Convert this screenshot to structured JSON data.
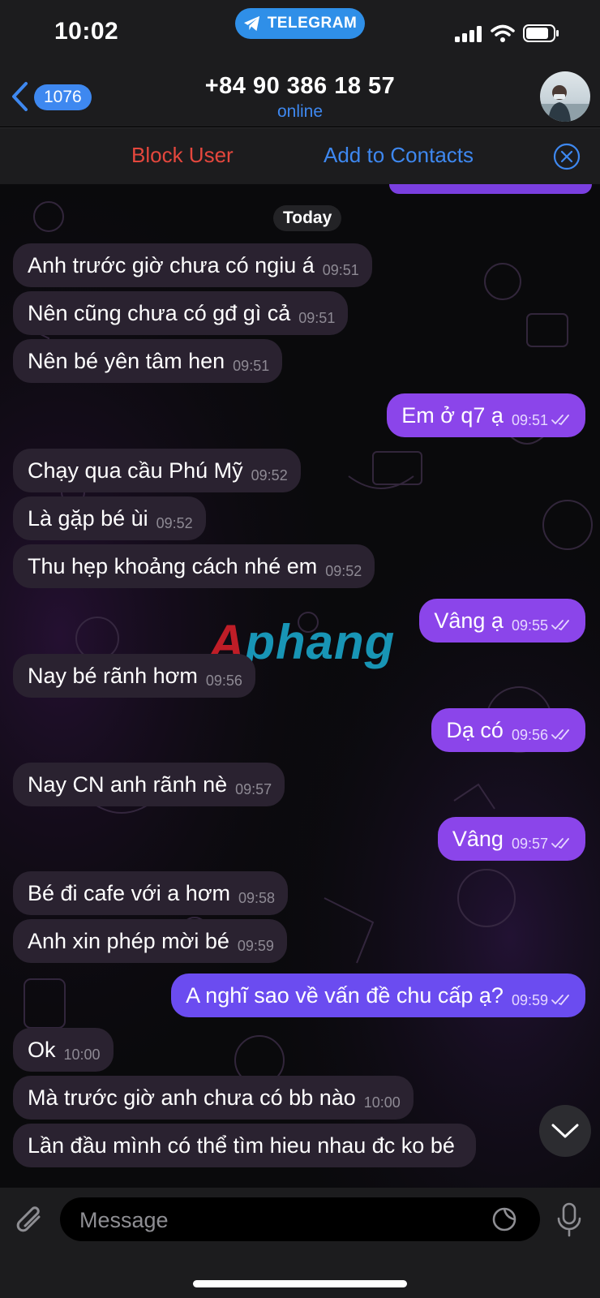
{
  "status_bar": {
    "time": "10:02",
    "app_pill": "TELEGRAM"
  },
  "nav": {
    "back_count": "1076",
    "title": "+84 90 386 18 57",
    "subtitle": "online"
  },
  "actions": {
    "block": "Block User",
    "add": "Add to Contacts"
  },
  "chat": {
    "date_label": "Today",
    "watermark_a": "A",
    "watermark_rest": "phang",
    "messages": [
      {
        "dir": "in",
        "text": "Anh trước giờ chưa có ngiu á",
        "time": "09:51"
      },
      {
        "dir": "in",
        "text": "Nên cũng chưa có gđ gì cả",
        "time": "09:51"
      },
      {
        "dir": "in",
        "text": "Nên bé yên tâm hen",
        "time": "09:51"
      },
      {
        "dir": "out",
        "text": "Em ở q7 ạ",
        "time": "09:51"
      },
      {
        "dir": "in",
        "text": "Chạy qua cầu Phú Mỹ",
        "time": "09:52"
      },
      {
        "dir": "in",
        "text": "Là gặp bé ùi",
        "time": "09:52"
      },
      {
        "dir": "in",
        "text": "Thu hẹp khoảng cách nhé em",
        "time": "09:52"
      },
      {
        "dir": "out",
        "text": "Vâng ạ",
        "time": "09:55"
      },
      {
        "dir": "in",
        "text": "Nay bé rãnh hơm",
        "time": "09:56"
      },
      {
        "dir": "out",
        "text": "Dạ có",
        "time": "09:56"
      },
      {
        "dir": "in",
        "text": "Nay CN anh rãnh nè",
        "time": "09:57"
      },
      {
        "dir": "out",
        "text": "Vâng",
        "time": "09:57"
      },
      {
        "dir": "in",
        "text": "Bé đi cafe với a hơm",
        "time": "09:58"
      },
      {
        "dir": "in",
        "text": "Anh xin phép mời bé",
        "time": "09:59"
      },
      {
        "dir": "out",
        "text": "A nghĩ sao về vấn đề chu cấp ạ?",
        "time": "09:59"
      },
      {
        "dir": "in",
        "text": "Ok",
        "time": "10:00"
      },
      {
        "dir": "in",
        "text": "Mà trước giờ anh chưa có bb nào",
        "time": "10:00"
      },
      {
        "dir": "in",
        "text": "Lần đầu mình có thể tìm hieu nhau đc ko bé",
        "time": ""
      }
    ]
  },
  "input": {
    "placeholder": "Message"
  },
  "colors": {
    "accent": "#3e88f0",
    "danger": "#e5473d",
    "outgoing": "#8b45ea",
    "incoming": "#2a2230"
  },
  "icons": [
    "telegram-icon",
    "signal-icon",
    "wifi-icon",
    "battery-icon",
    "back-chevron-icon",
    "close-circle-icon",
    "read-checks-icon",
    "scroll-down-icon",
    "attach-icon",
    "sticker-icon",
    "mic-icon"
  ]
}
